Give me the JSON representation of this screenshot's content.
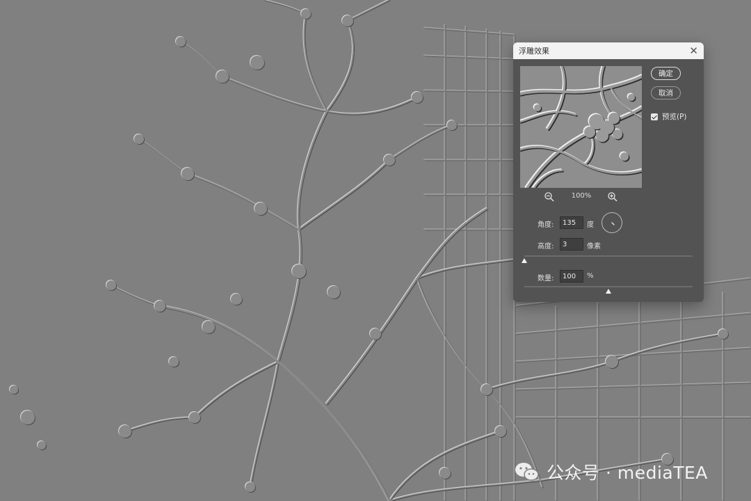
{
  "dialog": {
    "title": "浮雕效果",
    "ok_label": "确定",
    "cancel_label": "取消",
    "preview_label": "预览(P)",
    "preview_checked": true,
    "zoom_level": "100%",
    "angle": {
      "label": "角度:",
      "value": "135",
      "unit": "度"
    },
    "height": {
      "label": "高度:",
      "value": "3",
      "unit": "像素"
    },
    "amount": {
      "label": "数量:",
      "value": "100",
      "unit": "%"
    },
    "height_slider_fraction": 0.0,
    "amount_slider_fraction": 0.5
  },
  "watermark": {
    "text": "公众号 · mediaTEA"
  },
  "icons": [
    "close-icon",
    "zoom-out-icon",
    "zoom-in-icon",
    "wechat-icon"
  ],
  "colors": {
    "canvas": "#808080",
    "dialog": "#535353",
    "titlebar": "#f3f3f3"
  }
}
